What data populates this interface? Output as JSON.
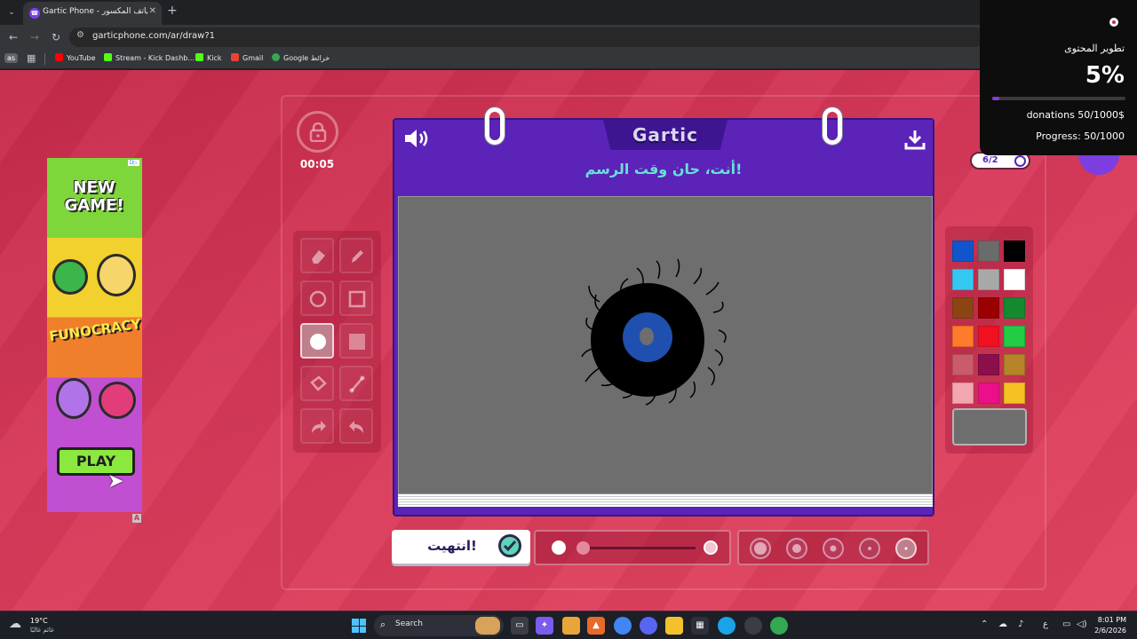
{
  "browser": {
    "tab_title": "Gartic Phone - الهاتف المكسور",
    "tab_close": "✕",
    "new_tab": "+",
    "url": "garticphone.com/ar/draw?1",
    "profile_badge": "as",
    "bookmarks": [
      {
        "label": "YouTube",
        "color": "#ff0000"
      },
      {
        "label": "Stream - Kick Dashb...",
        "color": "#53fc18"
      },
      {
        "label": "Kick",
        "color": "#53fc18"
      },
      {
        "label": "Gmail",
        "color": "#ea4335"
      },
      {
        "label": "Google خرائط",
        "color": "#34a853"
      }
    ]
  },
  "ad": {
    "badge": "D▷",
    "headline": "NEW GAME!",
    "brand": "FUNOCRACY",
    "play_label": "PLAY",
    "corner_label": "A"
  },
  "game": {
    "timer": "00:05",
    "logo": "Gartic",
    "prompt": "أنت، حان وقت الرسم!",
    "done_label": "انتهيت!",
    "round_counter": "6/2",
    "colors": [
      "#1155cc",
      "#6b6b6b",
      "#000000",
      "#33c8f2",
      "#a8a8a8",
      "#ffffff",
      "#8b4513",
      "#9b0000",
      "#148a2e",
      "#ff7a2a",
      "#f01020",
      "#22cc44",
      "#c95b6a",
      "#8b0f4a",
      "#b8842a",
      "#f4a6b0",
      "#ec0f8a",
      "#f5c122"
    ],
    "selected_color": "#6e6e6e",
    "accent_purple": "#5b23b8",
    "accent_teal": "#67e1d6"
  },
  "overlay": {
    "title": "تطوير المحتوى",
    "percent": "5%",
    "progress_fraction": 0.05,
    "donations": "donations 50/1000$",
    "progress": "Progress: 50/1000"
  },
  "taskbar": {
    "temperature": "19°C",
    "weather": "غائم غالبًا",
    "search_label": "Search",
    "lang": "ع",
    "time": "8:01 PM",
    "date": "2/6/2026"
  }
}
